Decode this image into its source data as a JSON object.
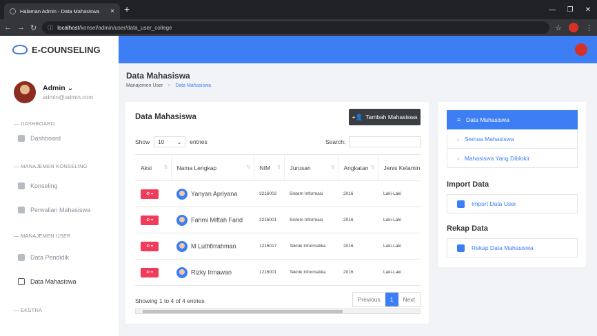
{
  "browser": {
    "tab_title": "Halaman Admin - Data Mahasiswa",
    "url_host": "localhost",
    "url_path": "/konsel/admin/user/data_user_college",
    "new_tab": "+",
    "tab_close": "×",
    "star": "☆"
  },
  "brand": {
    "name": "E-COUNSELING",
    "accent": "#3d7ef5"
  },
  "user": {
    "name": "Admin ⌄",
    "email": "admin@admin.com"
  },
  "sidebar": {
    "sections": [
      {
        "label": "— DASHBOARD"
      },
      {
        "label": "— MANAJEMEN KONSELING"
      },
      {
        "label": "— MANAJEMEN USER"
      },
      {
        "label": "— EKSTRA"
      }
    ],
    "items": [
      {
        "label": "Dashboard",
        "icon": "dashboard-icon"
      },
      {
        "label": "Konseling",
        "icon": "chat-icon"
      },
      {
        "label": "Perwalian Mahasiswa",
        "icon": "group-icon"
      },
      {
        "label": "Data Pendidik",
        "icon": "id-card-icon"
      },
      {
        "label": "Data Mahasiswa",
        "icon": "student-icon"
      }
    ]
  },
  "page": {
    "title": "Data Mahasiswa",
    "breadcrumb_home": "Manajemen User",
    "breadcrumb_sep": ">",
    "breadcrumb_current": "Data Mahasiswa"
  },
  "card": {
    "title": "Data Mahasiswa",
    "add_button": "Tambah Mahasiswa",
    "show_label": "Show",
    "entries_value": "10",
    "entries_label": "entries",
    "search_label": "Search:",
    "columns": [
      "Aksi",
      "Nama Lengkap",
      "NIM",
      "Jurusan",
      "Angkatan",
      "Jenis Kelamin"
    ],
    "rows": [
      {
        "aksi": "⚙ ▾",
        "nama": "Yanyan Apriyana",
        "nim": "3216002",
        "jurusan": "Sistem Informasi",
        "angkatan": "2016",
        "jk": "Laki-Laki"
      },
      {
        "aksi": "⚙ ▾",
        "nama": "Fahmi Miftah Farid",
        "nim": "3216001",
        "jurusan": "Sistem Informasi",
        "angkatan": "2016",
        "jk": "Laki-Laki"
      },
      {
        "aksi": "⚙ ▾",
        "nama": "M Luthfirrahman",
        "nim": "1216017",
        "jurusan": "Teknik Informatika",
        "angkatan": "2016",
        "jk": "Laki-Laki"
      },
      {
        "aksi": "⚙ ▾",
        "nama": "Rizky Irmawan",
        "nim": "1216001",
        "jurusan": "Teknik Informatika",
        "angkatan": "2016",
        "jk": "Laki-Laki"
      }
    ],
    "footer": "Showing 1 to 4 of 4 entries",
    "prev": "Previous",
    "page": "1",
    "next": "Next"
  },
  "side": {
    "menu": [
      "Data Mahasiswa",
      "Semua Mahasiswa",
      "Mahasiswa Yang Diblokir"
    ],
    "import_title": "Import Data",
    "import_button": "Import Data User",
    "rekap_title": "Rekap Data",
    "rekap_button": "Rekap Data Mahasiswa"
  }
}
